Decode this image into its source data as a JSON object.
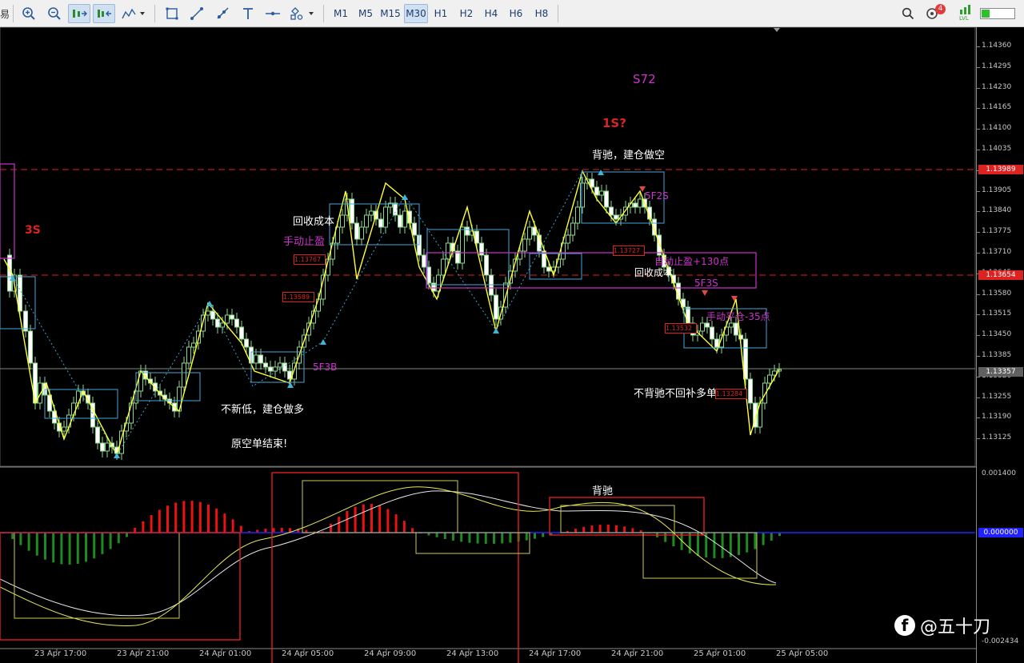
{
  "toolbar": {
    "left_fragment": "易",
    "timeframes": [
      "M1",
      "M5",
      "M15",
      "M30",
      "H1",
      "H2",
      "H4",
      "H6",
      "H8"
    ],
    "active_timeframe": "M30",
    "notification_count": "4",
    "lvl_label": "LVL"
  },
  "price_axis": {
    "labels": [
      "1.14360",
      "1.14295",
      "1.14230",
      "1.14165",
      "1.14100",
      "1.14035",
      "1.13970",
      "1.13905",
      "1.13840",
      "1.13775",
      "1.13710",
      "1.13645",
      "1.13580",
      "1.13515",
      "1.13450",
      "1.13385",
      "1.13320",
      "1.13255",
      "1.13190",
      "1.13125"
    ],
    "tag_upper": "1.13989",
    "tag_lower": "1.13654",
    "tag_current": "1.13357",
    "indicator_labels": [
      "0.001400",
      "0.000000",
      "-0.002434"
    ]
  },
  "time_axis": [
    "23 Apr 17:00",
    "23 Apr 21:00",
    "24 Apr 01:00",
    "24 Apr 05:00",
    "24 Apr 09:00",
    "24 Apr 13:00",
    "24 Apr 17:00",
    "24 Apr 21:00",
    "25 Apr 01:00",
    "25 Apr 05:00"
  ],
  "annotations": {
    "s72": "S72",
    "s1": "1S?",
    "bei_chi_short": "背驰，建仓做空",
    "s3": "3S",
    "recover_cost_1": "回收成本",
    "manual_tp": "手动止盈",
    "f2s": "5F2S",
    "auto_tp": "自动止盈+130点",
    "recover_cost_2": "回收成本",
    "f3s": "5F3S",
    "manual_close": "手动平仓-35点",
    "f3b": "5F3B",
    "no_new_low": "不新低，建仓做多",
    "orig_short_end": "原空单结束!",
    "no_divergence": "不背驰不回补多单",
    "bei_chi_ind": "背驰"
  },
  "order_tags": [
    "1.13767",
    "1.13589",
    "1.13727",
    "1.13532",
    "1.13284"
  ],
  "watermark": "@五十刀",
  "colors": {
    "background": "#000000",
    "bull_candle": "#ffffff",
    "bear_candle": "#ffffff",
    "zigzag": "#ffff33",
    "pivot_box": "#4aa3d8",
    "magenta": "#cc33cc",
    "red": "#dd2222",
    "hist_up": "#ee1111",
    "hist_down": "#1f8a1f",
    "zero_line": "#2222ff"
  }
}
